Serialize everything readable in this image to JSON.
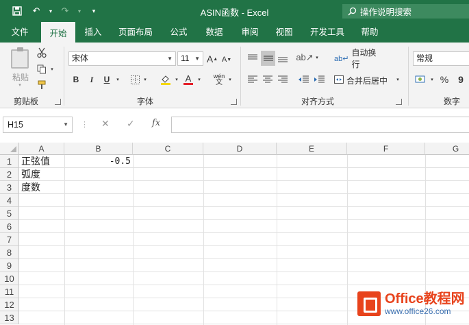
{
  "titlebar": {
    "title": "ASIN函数  -  Excel",
    "search_placeholder": "操作说明搜索",
    "accent": "#217346"
  },
  "tabs": [
    {
      "label": "文件"
    },
    {
      "label": "开始"
    },
    {
      "label": "插入"
    },
    {
      "label": "页面布局"
    },
    {
      "label": "公式"
    },
    {
      "label": "数据"
    },
    {
      "label": "审阅"
    },
    {
      "label": "视图"
    },
    {
      "label": "开发工具"
    },
    {
      "label": "帮助"
    }
  ],
  "ribbon": {
    "clipboard": {
      "paste_label": "粘贴",
      "group_label": "剪贴板"
    },
    "font": {
      "font_name": "宋体",
      "font_size": "11",
      "bold": "B",
      "italic": "I",
      "underline": "U",
      "grow": "A",
      "shrink": "A",
      "font_color": "A",
      "phonetic": "wén",
      "group_label": "字体"
    },
    "alignment": {
      "wrap_text": "自动换行",
      "merge_center": "合并后居中",
      "group_label": "对齐方式"
    },
    "number": {
      "format": "常规",
      "percent": "%",
      "comma": "9",
      "group_label": "数字"
    }
  },
  "formulabar": {
    "namebox": "H15",
    "cancel": "✕",
    "enter": "✓",
    "fx": "fx",
    "formula": ""
  },
  "sheet": {
    "columns": [
      "A",
      "B",
      "C",
      "D",
      "E",
      "F",
      "G"
    ],
    "rows": [
      "1",
      "2",
      "3",
      "4",
      "5",
      "6",
      "7",
      "8",
      "9",
      "10",
      "11",
      "12",
      "13"
    ],
    "cells": {
      "A1": "正弦值",
      "B1": "-0.5",
      "A2": "弧度",
      "A3": "度数"
    }
  },
  "watermark": {
    "brand": "Office教程网",
    "url": "www.office26.com"
  }
}
